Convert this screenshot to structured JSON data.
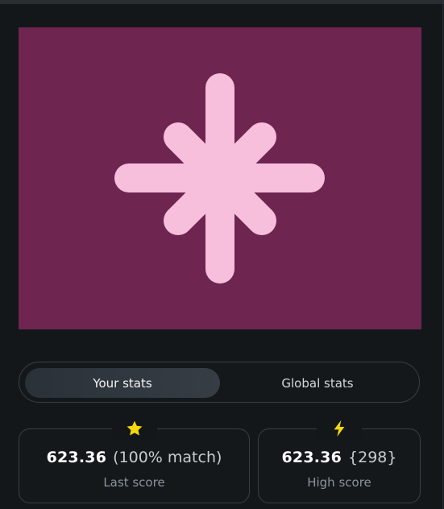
{
  "artwork": {
    "background_color": "#6e2550",
    "shape_color": "#f7bfdc",
    "shape": "eight-point-asterisk-icon"
  },
  "tabs": [
    {
      "label": "Your stats",
      "active": true
    },
    {
      "label": "Global stats",
      "active": false
    }
  ],
  "stats": {
    "last": {
      "icon": "star-icon",
      "icon_color": "#f5d90a",
      "score": "623.36",
      "extra": "(100% match)",
      "label": "Last score"
    },
    "high": {
      "icon": "lightning-bolt-icon",
      "icon_color": "#f5d90a",
      "score": "623.36",
      "extra": "{298}",
      "label": "High score"
    }
  }
}
